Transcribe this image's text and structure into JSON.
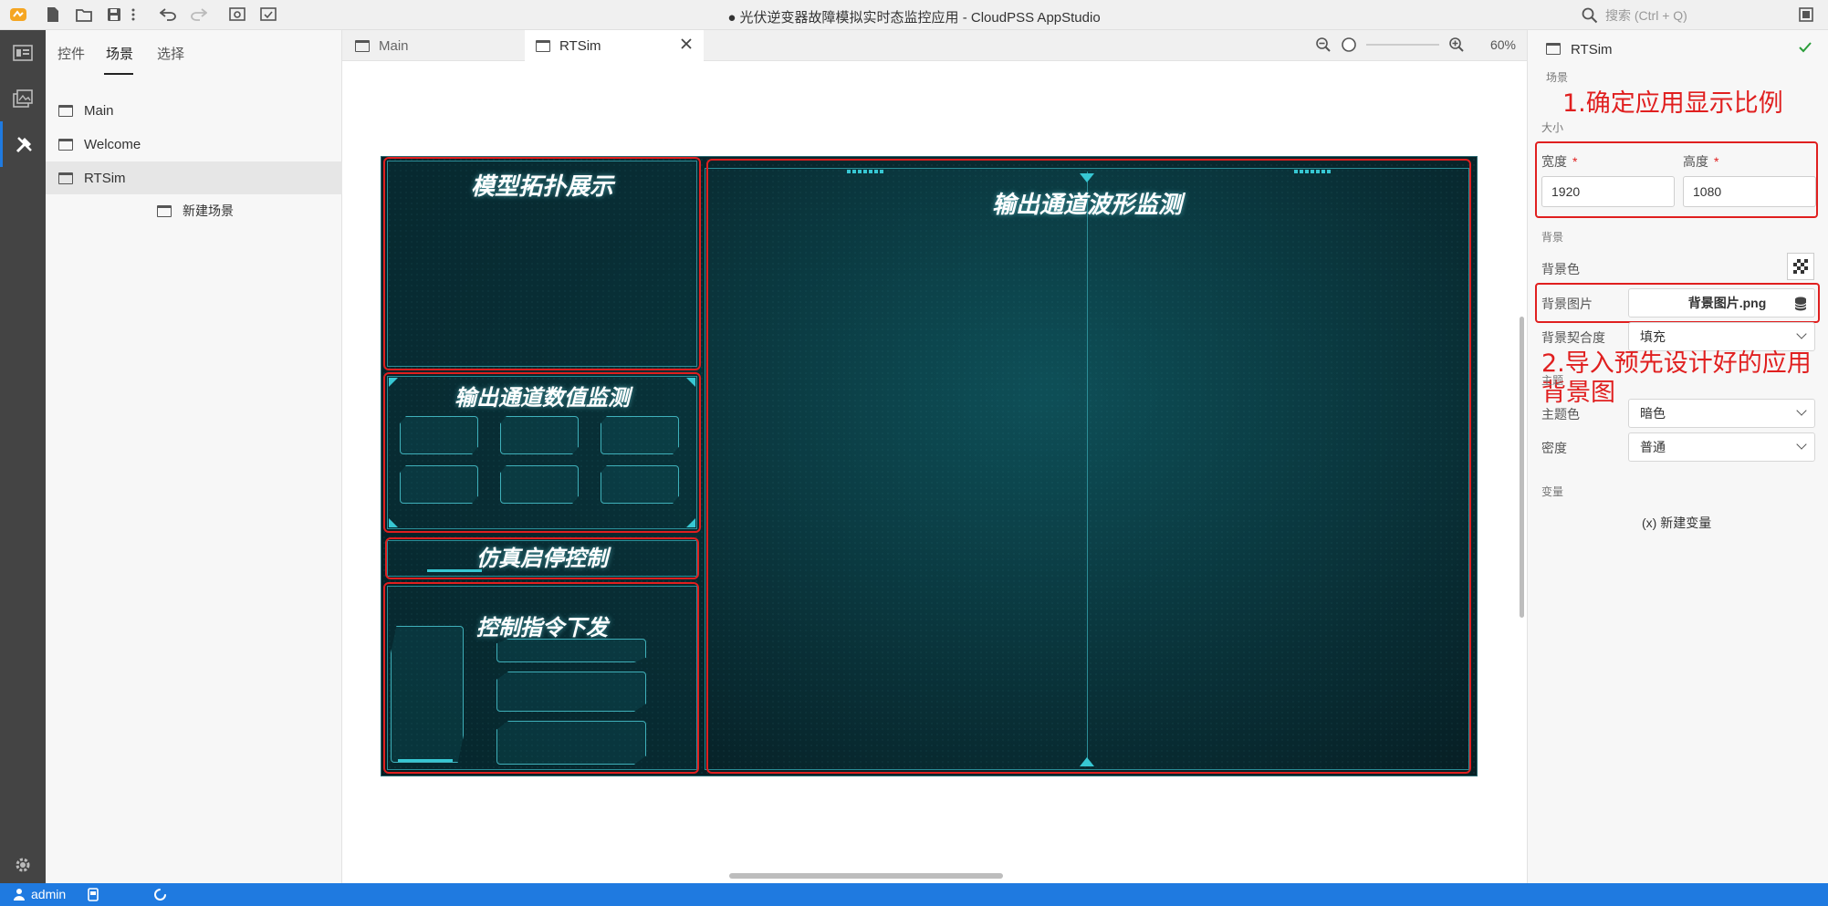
{
  "titlebar": {
    "title": "● 光伏逆变器故障模拟实时态监控应用 - CloudPSS AppStudio",
    "search_placeholder": "搜索 (Ctrl + Q)"
  },
  "left_panel": {
    "tabs": [
      "控件",
      "场景",
      "选择"
    ],
    "active_tab": "场景",
    "scenes": [
      "Main",
      "Welcome",
      "RTSim"
    ],
    "selected_scene": "RTSim",
    "new_scene_label": "新建场景"
  },
  "editor": {
    "tabs": [
      "Main",
      "RTSim"
    ],
    "active_tab": "RTSim",
    "zoom": "60%"
  },
  "preview": {
    "panels": {
      "topology": "模型拓扑展示",
      "waveform": "输出通道波形监测",
      "numeric": "输出通道数值监测",
      "sim_control": "仿真启停控制",
      "command": "控制指令下发"
    }
  },
  "right_panel": {
    "scene_name": "RTSim",
    "section_scene": "场景",
    "section_size": "大小",
    "width_label": "宽度",
    "width_value": "1920",
    "height_label": "高度",
    "height_value": "1080",
    "section_background": "背景",
    "bg_color_label": "背景色",
    "bg_image_label": "背景图片",
    "bg_image_value": "背景图片.png",
    "bg_fit_label": "背景契合度",
    "bg_fit_value": "填充",
    "section_theme": "主题",
    "theme_color_label": "主题色",
    "theme_color_value": "暗色",
    "density_label": "密度",
    "density_value": "普通",
    "section_vars": "变量",
    "new_var_label": "(x)  新建变量"
  },
  "annotations": {
    "step1": "1.确定应用显示比例",
    "step2": "2.导入预先设计好的应用背景图"
  },
  "statusbar": {
    "user": "admin"
  },
  "colors": {
    "accent": "#1f7ae0",
    "annotation_red": "#e01f1f",
    "preview_bg": "#08262c",
    "preview_accent": "#37c7d3"
  }
}
